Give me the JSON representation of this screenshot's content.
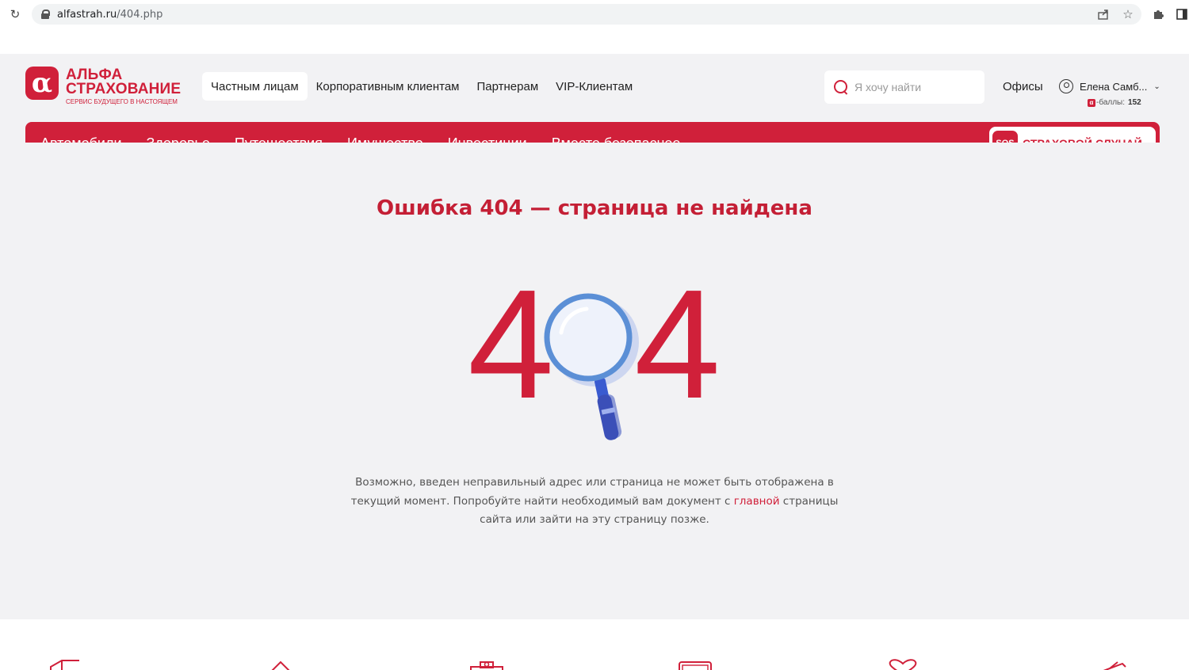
{
  "browser": {
    "url_host": "alfastrah.ru",
    "url_path": "/404.php"
  },
  "logo": {
    "mark": "α",
    "line1": "АЛЬФА",
    "line1b": "СТРАХОВАНИЕ",
    "tagline": "СЕРВИС БУДУЩЕГО В НАСТОЯЩЕМ"
  },
  "top_nav": [
    {
      "label": "Частным лицам",
      "active": true
    },
    {
      "label": "Корпоративным клиентам",
      "active": false
    },
    {
      "label": "Партнерам",
      "active": false
    },
    {
      "label": "VIP-Клиентам",
      "active": false
    }
  ],
  "search": {
    "placeholder": "Я хочу найти"
  },
  "offices_label": "Офисы",
  "user": {
    "name": "Елена Самб...",
    "points_label": "-баллы:",
    "points_value": "152"
  },
  "categories": [
    "Автомобили",
    "Здоровье",
    "Путешествия",
    "Имущество",
    "Инвестиции",
    "Вместе безопаснее"
  ],
  "sos": {
    "badge": "SOS",
    "label": "СТРАХОВОЙ СЛУЧАЙ"
  },
  "error": {
    "title": "Ошибка 404 — страница не найдена",
    "digit_left": "4",
    "digit_right": "4",
    "text_part1": "Возможно, введен неправильный адрес или страница не может быть отображена в текущий момент. Попробуйте найти необходимый вам документ с ",
    "link_text": "главной",
    "text_part2": " страницы сайта или зайти на эту страницу позже."
  },
  "colors": {
    "brand": "#d0203a",
    "background": "#f2f2f4",
    "magnifier": "#5b8fd6"
  }
}
